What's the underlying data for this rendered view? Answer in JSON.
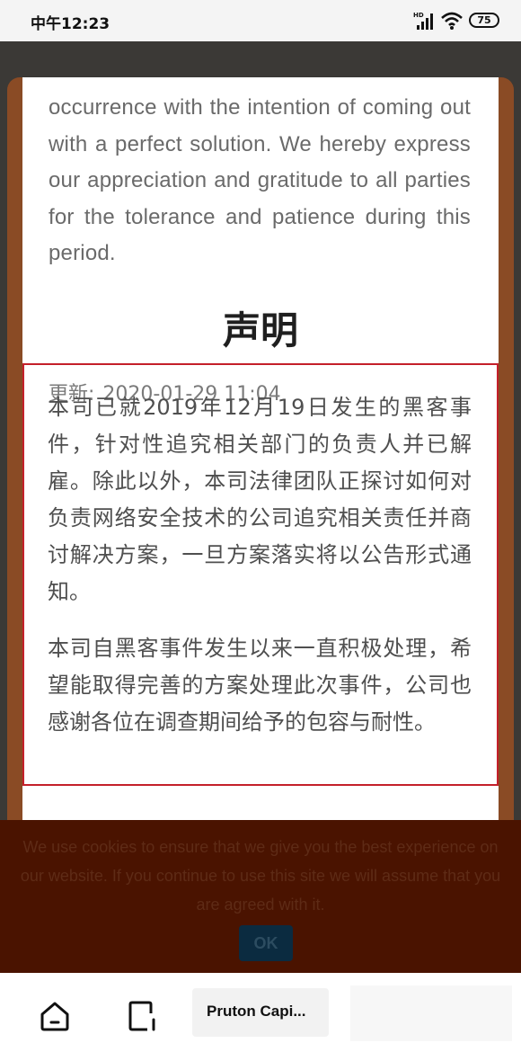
{
  "status_bar": {
    "time": "中午12:23",
    "signal_badge": "HD",
    "battery": "75"
  },
  "article": {
    "english_text": "occurrence with the intention of coming out with a perfect solution. We hereby express our appreciation and gratitude to all parties for the tolerance and patience during this period.",
    "heading": "声明",
    "update_label": "更新:",
    "update_time": "2020-01-29 11:04",
    "paragraph_1": "本司已就2019年12月19日发生的黑客事件，针对性追究相关部门的负责人并已解雇。除此以外，本司法律团队正探讨如何对负责网络安全技术的公司追究相关责任并商讨解决方案，一旦方案落实将以公告形式通知。",
    "paragraph_2": "本司自黑客事件发生以来一直积极处理，希望能取得完善的方案处理此次事件，公司也感谢各位在调查期间给予的包容与耐性。"
  },
  "cookie_banner": {
    "message": "We use cookies to ensure that we give you the best experience on our website. If you continue to use this site we will assume that you are agreed with it.",
    "ok_label": "OK"
  },
  "bottom_nav": {
    "app_label": "Pruton Capi..."
  },
  "colors": {
    "highlight_border": "#c4202a",
    "modal_frame": "#8a4b25",
    "cookie_bg": "#4a1300",
    "ok_button": "#0b2b40"
  }
}
